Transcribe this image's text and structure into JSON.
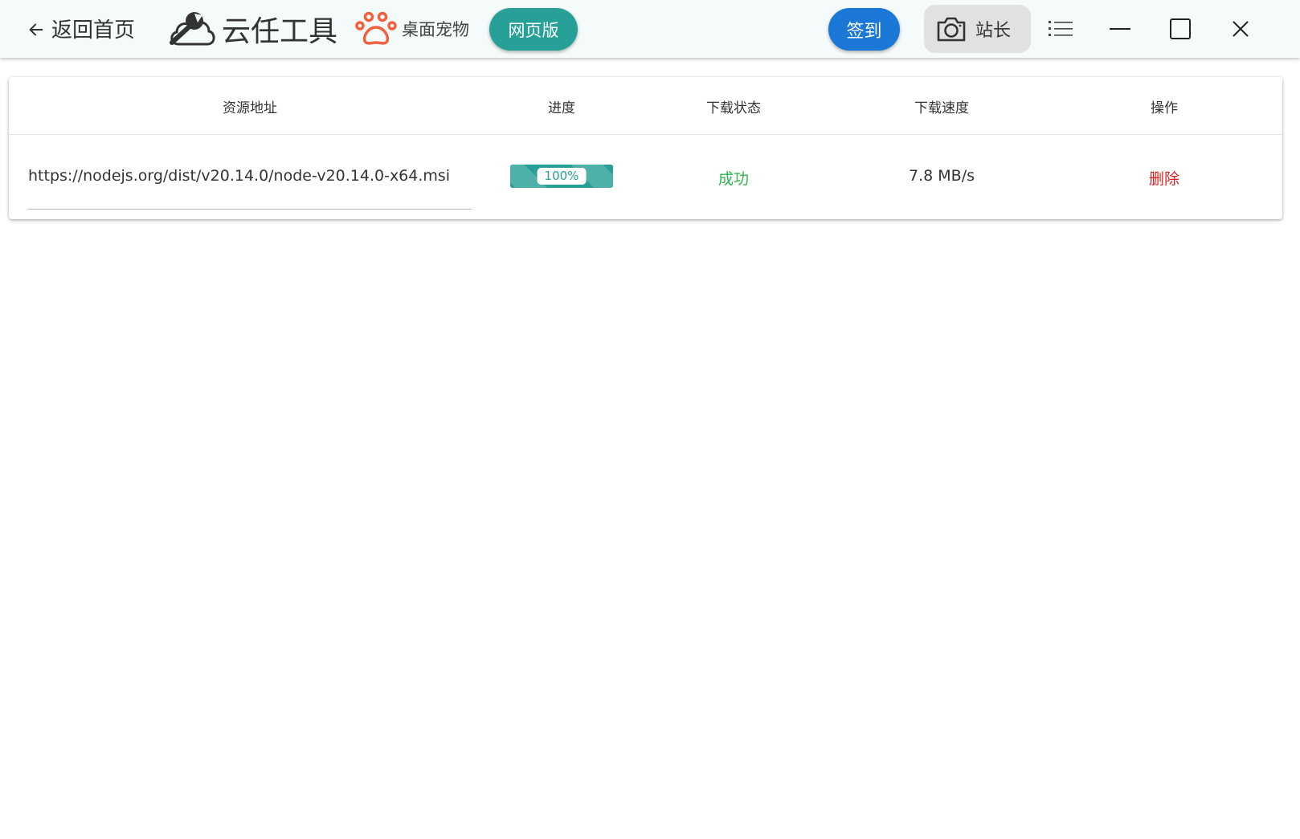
{
  "header": {
    "back_label": "返回首页",
    "app_name": "云任工具",
    "pet_label": "桌面宠物",
    "web_label": "网页版",
    "sign_label": "签到",
    "user_label": "站长"
  },
  "colors": {
    "accent": "#27a197",
    "sign_blue": "#1b78d6",
    "success": "#2fb54f",
    "danger": "#e01f1f",
    "pet_orange": "#f0613f"
  },
  "icons": [
    "back-arrow-icon",
    "wrench-cloud-icon",
    "paw-icon",
    "camera-icon",
    "menu-icon",
    "minimize-icon",
    "maximize-icon",
    "close-icon"
  ],
  "table": {
    "columns": [
      "资源地址",
      "进度",
      "下载状态",
      "下载速度",
      "操作"
    ],
    "rows": [
      {
        "url": "https://nodejs.org/dist/v20.14.0/node-v20.14.0-x64.msi",
        "progress": 100,
        "progress_label": "100%",
        "status": "成功",
        "speed": "7.8 MB/s",
        "action": "删除"
      }
    ]
  }
}
